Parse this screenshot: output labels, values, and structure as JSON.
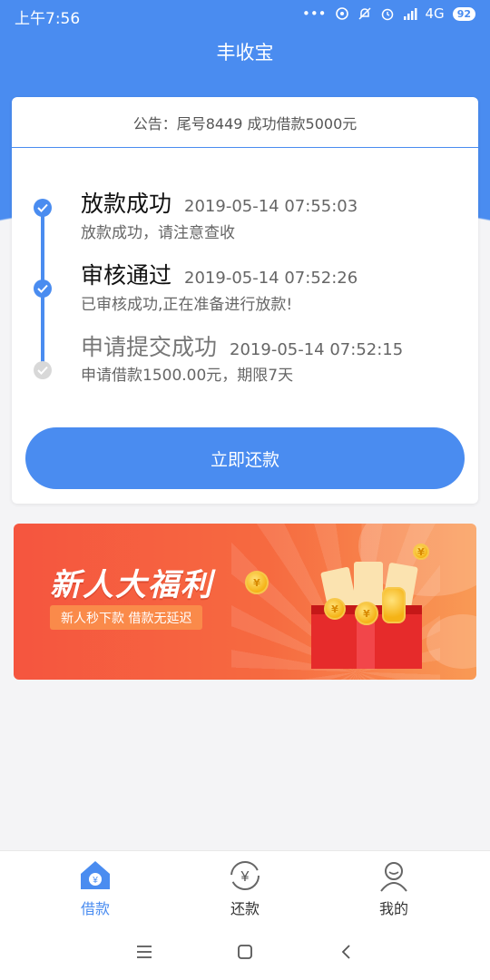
{
  "status_bar": {
    "time": "上午7:56",
    "network": "4G",
    "battery": "92"
  },
  "app": {
    "title": "丰收宝"
  },
  "notice": {
    "text": "公告：尾号8449 成功借款5000元"
  },
  "timeline": [
    {
      "title": "放款成功",
      "time": "2019-05-14 07:55:03",
      "desc": "放款成功，请注意查收",
      "state": "done"
    },
    {
      "title": "审核通过",
      "time": "2019-05-14 07:52:26",
      "desc": "已审核成功,正在准备进行放款!",
      "state": "done"
    },
    {
      "title": "申请提交成功",
      "time": "2019-05-14 07:52:15",
      "desc": "申请借款1500.00元，期限7天",
      "state": "pending"
    }
  ],
  "repay_button": {
    "label": "立即还款"
  },
  "banner": {
    "title": "新人大福利",
    "tag": "新人秒下款  借款无延迟"
  },
  "tabs": [
    {
      "label": "借款",
      "icon": "home-yen-icon",
      "active": true
    },
    {
      "label": "还款",
      "icon": "yen-refresh-icon",
      "active": false
    },
    {
      "label": "我的",
      "icon": "user-icon",
      "active": false
    }
  ],
  "colors": {
    "primary": "#4a8cf0",
    "background": "#f4f4f6",
    "banner": "#f5553f"
  }
}
